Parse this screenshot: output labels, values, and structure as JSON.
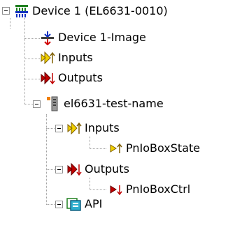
{
  "tree": {
    "root": {
      "label": "Device 1 (EL6631-0010)",
      "icon": "device-network-icon"
    },
    "image": {
      "label": "Device 1-Image",
      "icon": "device-image-icon"
    },
    "inputs": {
      "label": "Inputs",
      "icon": "inputs-icon"
    },
    "outputs": {
      "label": "Outputs",
      "icon": "outputs-icon"
    },
    "box": {
      "label": "el6631-test-name",
      "icon": "box-module-icon",
      "inputs": {
        "label": "Inputs",
        "icon": "inputs-icon",
        "var": {
          "label": "PnIoBoxState",
          "icon": "input-variable-icon"
        }
      },
      "outputs": {
        "label": "Outputs",
        "icon": "outputs-icon",
        "var": {
          "label": "PnIoBoxCtrl",
          "icon": "output-variable-icon"
        }
      },
      "api": {
        "label": "API",
        "icon": "api-icon"
      }
    }
  },
  "colors": {
    "line": "#a0a0a0",
    "input_yellow": "#f0d000",
    "output_red": "#c00000",
    "arrow_blue": "#1030c0"
  }
}
